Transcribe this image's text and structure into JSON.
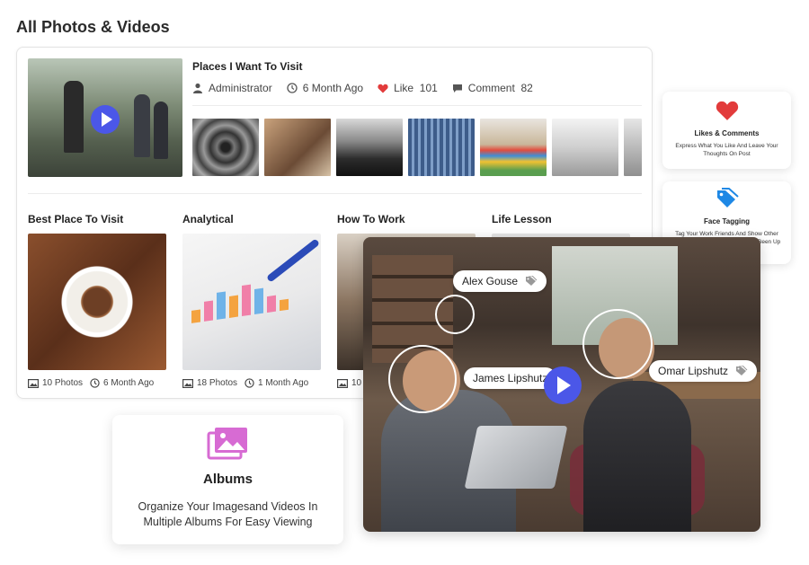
{
  "page": {
    "title": "All Photos & Videos"
  },
  "post": {
    "title": "Places I Want To Visit",
    "author": "Administrator",
    "time": "6 Month Ago",
    "like_label": "Like",
    "like_count": "101",
    "comment_label": "Comment",
    "comment_count": "82"
  },
  "albums": [
    {
      "title": "Best Place To Visit",
      "photos": "10 Photos",
      "time": "6 Month Ago"
    },
    {
      "title": "Analytical",
      "photos": "18 Photos",
      "time": "1 Month Ago"
    },
    {
      "title": "How To Work",
      "photos": "10",
      "time": ""
    },
    {
      "title": "Life Lesson",
      "photos": "",
      "time": ""
    }
  ],
  "features": {
    "likes": {
      "title": "Likes & Comments",
      "desc": "Express What You Like And Leave Your Thoughts On Post"
    },
    "tagging": {
      "title": "Face Tagging",
      "desc": "Tag Your Work Friends And Show Other Collegues What You Guys Have Been Up To"
    },
    "albums": {
      "title": "Albums",
      "desc": "Organize Your Imagesand Videos In Multiple Albums For Easy Viewing"
    }
  },
  "tags": {
    "tag1": "Alex Gouse",
    "tag2": "James Lipshutz",
    "tag3": "Omar Lipshutz"
  },
  "icons": {
    "user": "user-icon",
    "clock": "clock-icon",
    "heart": "heart-icon",
    "comment": "comment-icon",
    "photos": "photos-icon",
    "play": "play-icon",
    "tag": "tag-icon",
    "album": "album-icon"
  },
  "colors": {
    "accent": "#4b57e8",
    "heart": "#e23b3b",
    "tag_blue": "#1e88e5",
    "album_pink": "#d76bd3"
  }
}
